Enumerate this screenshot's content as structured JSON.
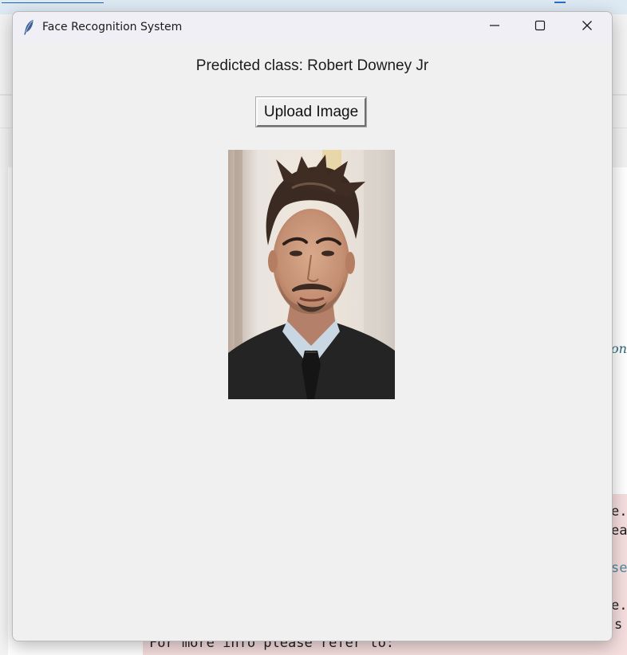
{
  "window": {
    "title": "Face Recognition System",
    "controls": {
      "minimize_icon": "minimize-icon",
      "maximize_icon": "maximize-icon",
      "close_icon": "close-icon"
    },
    "app_icon": "feather-icon"
  },
  "main": {
    "prediction_text": "Predicted class: Robert Downey Jr",
    "upload_button_label": "Upload Image",
    "image": {
      "kind": "portrait-photo",
      "description_icon": "face-photo"
    }
  },
  "background": {
    "error_line_bottom": "For more info please refer to:",
    "fragments_right": [
      "e.p",
      "ea",
      "se",
      "e.p",
      "s"
    ],
    "italic_fragment": "on"
  },
  "colors": {
    "window_bg": "#f0f0f0",
    "titlebar_bg": "#f0eff5",
    "error_bg": "#f6dede",
    "link_blue": "#1d62b5"
  }
}
